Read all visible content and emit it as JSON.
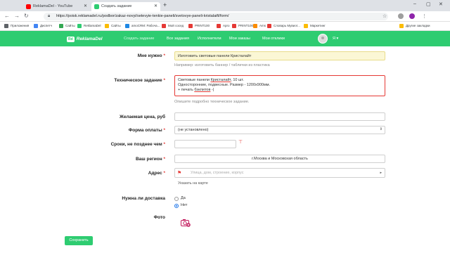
{
  "browser": {
    "tabs": [
      {
        "label": "ReklamaDel - YouTube",
        "favicon_color": "#ff0000"
      },
      {
        "label": "Создать задание",
        "favicon_color": "#2ecc71",
        "active": true
      }
    ],
    "new_tab": "+",
    "url": "https://poisk.reklamadel.ru/podbor/zakaz-novyi/setevyie-tenkie-paneli/svetovye-paneli-kristalaift/form/",
    "bookmarks": [
      {
        "label": "Приложения",
        "color": "#5f6368"
      },
      {
        "label": "Диспетч",
        "color": "#4285f4"
      },
      {
        "label": "Сайты",
        "color": "#34a853"
      },
      {
        "label": "ReklamaDel",
        "color": "#2ecc71"
      },
      {
        "label": "Сайты",
        "color": "#fbbc05"
      },
      {
        "label": "amoCRM: Рабоча...",
        "color": "#1e88e5"
      },
      {
        "label": "Мой сосед",
        "color": "#e53935"
      },
      {
        "label": "PRINT100",
        "color": "#e53935"
      },
      {
        "label": "Apro",
        "color": "#e53935"
      },
      {
        "label": "PRINT100",
        "color": "#e53935"
      },
      {
        "label": "Ams",
        "color": "#fb8c00"
      },
      {
        "label": "Словарь Мувиэт...",
        "color": "#e53935"
      },
      {
        "label": "Маркетинг",
        "color": "#fbbc05"
      },
      {
        "label": "Другие закладки",
        "color": "#fbbc05"
      }
    ]
  },
  "site": {
    "logo_badge": "Rd",
    "logo_text": "ReklamaDel",
    "nav": {
      "create": "Создать задание",
      "all": "Все задания",
      "performers": "Исполнители",
      "my_orders": "Мои заказы",
      "my_responses": "Мои отклики"
    },
    "user_menu": "Я ▾"
  },
  "form": {
    "need": {
      "label": "Мне нужно",
      "value": "Изготовить световые панели Кристалайт",
      "hint": "Например: изготовить баннер / таблички из пластика"
    },
    "spec": {
      "label": "Техническое задание",
      "line1_prefix": "Световые панели ",
      "line1_word": "Кристалайт",
      "line1_suffix": ", 10 шт.",
      "line2": "Односторонние, подвесные. Размер - 1200х900мм.",
      "line3_prefix": "+ печать ",
      "line3_word": "бэклитов",
      "line3_suffix": " -|",
      "hint": "Опишите подробно техническое задание."
    },
    "price": {
      "label": "Желаемая цена, руб",
      "value": ""
    },
    "payment": {
      "label": "Форма оплаты",
      "value": "(не установлено)"
    },
    "deadline": {
      "label": "Сроки, не позднее чем",
      "value": ""
    },
    "region": {
      "label": "Ваш регион",
      "value": "г.Москва и Московская область"
    },
    "address": {
      "label": "Адрес",
      "placeholder": "Улица, дом, строение, корпус",
      "map_link": "Указать на карте"
    },
    "delivery": {
      "label": "Нужна ли доставка",
      "yes": "Да",
      "no": "Нет",
      "selected": "no"
    },
    "photo": {
      "label": "Фото"
    },
    "required_mark": "*",
    "save": "Сохранить"
  },
  "colors": {
    "brand": "#2ecc71",
    "error": "#e53935",
    "highlight": "#fbf7d5"
  }
}
